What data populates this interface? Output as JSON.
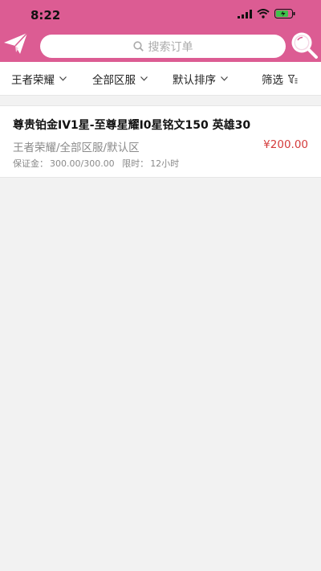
{
  "status_bar": {
    "time": "8:22"
  },
  "header": {
    "background": "#dc5c93",
    "search_placeholder": "搜索订单",
    "left_icon": "paper-plane-icon",
    "right_icon": "magnifier-icon"
  },
  "filters": [
    {
      "label": "王者荣耀"
    },
    {
      "label": "全部区服"
    },
    {
      "label": "默认排序"
    },
    {
      "label": "筛选"
    }
  ],
  "orders": [
    {
      "title": "尊贵铂金IV1星-至尊星耀I0星铭文150 英雄30",
      "meta": "王者荣耀/全部区服/默认区",
      "price": "¥200.00",
      "deposit_label": "保证金：",
      "deposit_value": "300.00/300.00",
      "time_label": "限时：",
      "time_value": "12小时"
    }
  ],
  "colors": {
    "accent": "#dc5c93",
    "price": "#d43b3b"
  }
}
